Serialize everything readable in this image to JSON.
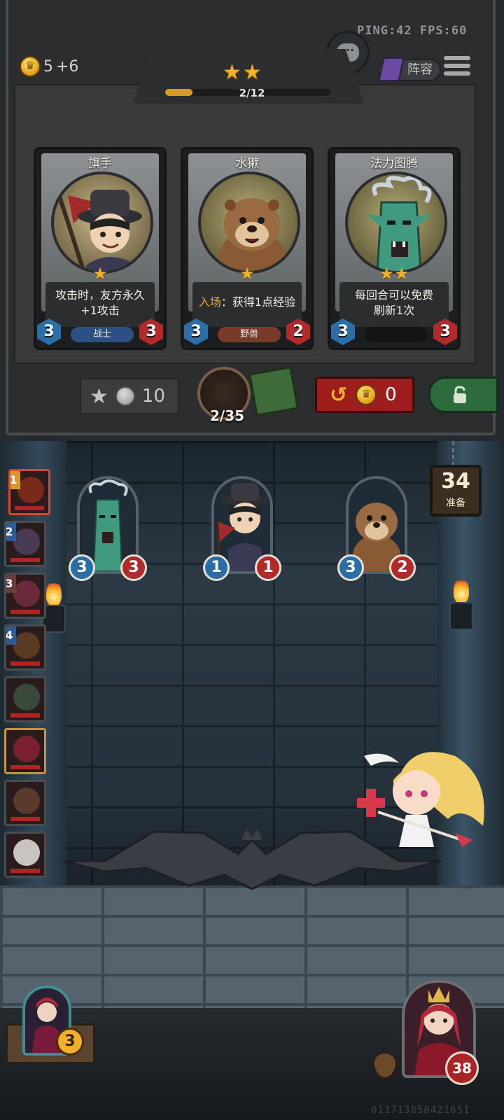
{
  "hud": {
    "ping_fps": "PING:42   FPS:60",
    "gold": "5",
    "gold_income": "+6",
    "lineup_label": "阵容"
  },
  "shop": {
    "tier_stars": "★★",
    "tier_level": 2,
    "xp_current": 2,
    "xp_max": 12,
    "xp_text": "2/12",
    "cards": [
      {
        "name": "旗手",
        "stars": "★",
        "desc_line1": "攻击时，友方永久",
        "desc_line2": "+1攻击",
        "keyword": "",
        "tribe": "战士",
        "tribe_color": "#2d4f86",
        "attack": "3",
        "health": "3"
      },
      {
        "name": "水獭",
        "stars": "★",
        "keyword": "入场",
        "desc_line1": "：获得1点经验",
        "desc_line2": "",
        "tribe": "野兽",
        "tribe_color": "#7a3a2a",
        "attack": "3",
        "health": "2"
      },
      {
        "name": "法力图腾",
        "stars": "★★",
        "desc_line1": "每回合可以免费",
        "desc_line2": "刷新1次",
        "keyword": "",
        "tribe": "",
        "tribe_color": "#141414",
        "attack": "3",
        "health": "3"
      }
    ],
    "upgrade_cost": "10",
    "deck_count": "2/35",
    "refresh_cost": "0"
  },
  "battle": {
    "ready_count": "34",
    "ready_label": "准备",
    "board": [
      {
        "name": "法力图腾",
        "attack": "3",
        "health": "3"
      },
      {
        "name": "旗手",
        "attack": "1",
        "health": "1"
      },
      {
        "name": "水獭",
        "attack": "3",
        "health": "2"
      }
    ],
    "players": [
      {
        "rank": "1",
        "color": "#7a2a1a"
      },
      {
        "rank": "2",
        "color": "#4a3a55"
      },
      {
        "rank": "3",
        "color": "#6a2a3a"
      },
      {
        "rank": "4",
        "color": "#5a3a22"
      },
      {
        "rank": "",
        "color": "#3a4a3a"
      },
      {
        "rank": "",
        "color": "#7a2030"
      },
      {
        "rank": "",
        "color": "#5a3a2a"
      },
      {
        "rank": "",
        "color": "#c9c4c0"
      }
    ],
    "hero_left_level": "3",
    "hero_right_hp": "38",
    "uid": "011713858421651"
  },
  "colors": {
    "accent_gold": "#f0b02a",
    "attack_blue": "#2a6fa8",
    "health_red": "#b22a2a",
    "refresh_red": "#9e1d1d",
    "lock_green": "#2d6b3d"
  }
}
